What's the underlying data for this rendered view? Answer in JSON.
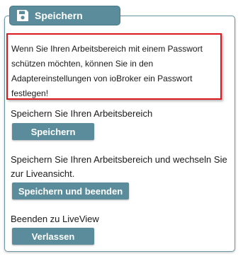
{
  "tab": {
    "label": "Speichern",
    "icon": "save-icon"
  },
  "notice": {
    "text": "Wenn Sie Ihren Arbeitsbereich mit einem Passwort schützen möchten, können Sie in den Adaptereinstellungen von ioBroker ein Passwort festlegen!"
  },
  "sections": {
    "save": {
      "text": "Speichern Sie Ihren Arbeitsbereich",
      "button_label": "Speichern"
    },
    "save_exit": {
      "text": "Speichern Sie Ihren Arbeitsbereich und wechseln Sie zur Liveansicht.",
      "button_label": "Speichern und beenden"
    },
    "exit": {
      "text": "Beenden zu LiveView",
      "button_label": "Verlassen"
    }
  },
  "colors": {
    "accent": "#5a8c9b",
    "notice_border": "#d9191f"
  }
}
